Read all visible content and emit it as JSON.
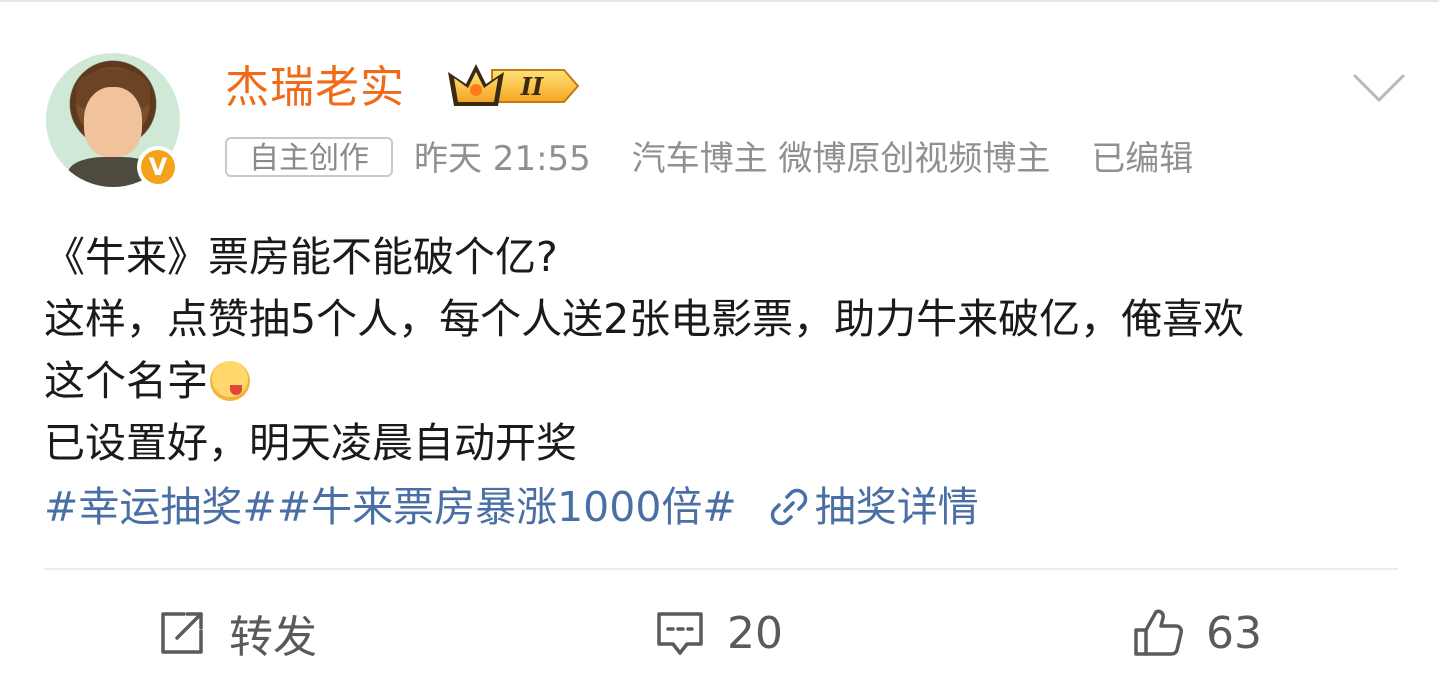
{
  "post": {
    "author": {
      "name": "杰瑞老实",
      "level_badge": "II",
      "verified": "V"
    },
    "meta": {
      "tag": "自主创作",
      "time": "昨天 21:55",
      "role": "汽车博主 微博原创视频博主",
      "edited": "已编辑"
    },
    "content": {
      "line1": "《牛来》票房能不能破个亿?",
      "line2": "这样，点赞抽5个人，每个人送2张电影票，助力牛来破亿，俺喜欢",
      "line3": "这个名字",
      "line4": "已设置好，明天凌晨自动开奖"
    },
    "topics": {
      "topic1": "#幸运抽奖#",
      "topic2": "#牛来票房暴涨1000倍#",
      "lottery_link": "抽奖详情"
    },
    "actions": {
      "repost_label": "转发",
      "comment_count": "20",
      "like_count": "63"
    }
  },
  "colors": {
    "username": "#f06a1a",
    "link": "#4a6fa5",
    "meta": "#909090",
    "text": "#1a1a1a"
  },
  "icons": [
    "chevron-down-icon",
    "crown-badge-icon",
    "verified-v-icon",
    "emoji-yum-icon",
    "link-icon",
    "repost-icon",
    "comment-icon",
    "like-icon"
  ]
}
